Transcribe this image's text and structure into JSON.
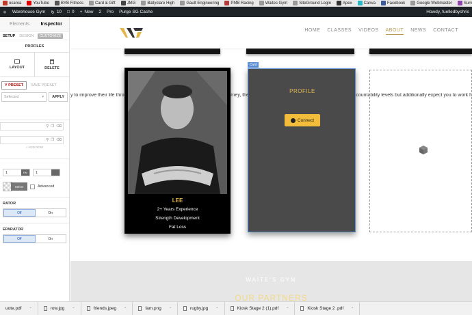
{
  "bookmarks": [
    {
      "label": "ocaroa",
      "color": "#c0392b"
    },
    {
      "label": "YouTube",
      "color": "#e00000"
    },
    {
      "label": "BYB Fitness",
      "color": "#555555"
    },
    {
      "label": "Card & Gift",
      "color": "#999999"
    },
    {
      "label": "JMG",
      "color": "#444444"
    },
    {
      "label": "Ballyclare High",
      "color": "#999999"
    },
    {
      "label": "Gault Engineering",
      "color": "#999999"
    },
    {
      "label": "PMB Racing",
      "color": "#b33a3a"
    },
    {
      "label": "Waites Gym",
      "color": "#999999"
    },
    {
      "label": "SiteGround Login",
      "color": "#999999"
    },
    {
      "label": "Apex",
      "color": "#333333"
    },
    {
      "label": "Canva",
      "color": "#2ab4c4"
    },
    {
      "label": "Facebook",
      "color": "#3b5998"
    },
    {
      "label": "Google Webmaster",
      "color": "#999999"
    },
    {
      "label": "Survey - Gi",
      "color": "#8e44ad"
    }
  ],
  "admin": {
    "site": "Warehouse Gym",
    "updates": "10",
    "comments": "0",
    "new": "New",
    "wpforms": "2",
    "pro": "Pro",
    "purge": "Purge SG Cache",
    "howdy": "Howdy, fuelledbychris"
  },
  "sidebar": {
    "tab_elements": "Elements",
    "tab_inspector": "Inspector",
    "setup": "SETUP",
    "design": "DESIGN",
    "customize": "CUSTOMIZE",
    "profiles": "PROFILES",
    "layout": "LAYOUT",
    "delete": "DELETE",
    "apply_preset": "Y PRESET",
    "save_preset": "SAVE PRESET",
    "selected": "Selected",
    "apply": "APPLY",
    "add_row": "+ ADD ROW",
    "num1": "1",
    "unit1": "EM",
    "num2": "1",
    "select": "Select",
    "advanced": "Advanced",
    "separator1": "RATOR",
    "off": "Off",
    "on": "On",
    "separator2": "EPARATOR"
  },
  "nav": {
    "links": [
      "HOME",
      "CLASSES",
      "VIDEOS",
      "ABOUT",
      "NEWS",
      "CONTACT"
    ],
    "current": "ABOUT"
  },
  "top_cards": [
    "Strength Development",
    "Fat Loss",
    ""
  ],
  "scroll_text": "y to improve their life through fitness is an incredible feeling. Fitness is a journey, there are no fast and easy solutions. I provide high accountability levels but additionally expect you to work hard. I want you",
  "card1": {
    "name": "LEE",
    "lines": [
      "2+ Years Experience",
      "Strength Development",
      "Fat Loss"
    ]
  },
  "card2": {
    "tag": "Card",
    "title": "PROFILE",
    "button": "Connect"
  },
  "footer": {
    "heading": "WAITE'S GYM",
    "sub": "OUR PARTNERS"
  },
  "downloads": [
    "uote.pdf",
    "row.jpg",
    "friends.jpeg",
    "fam.png",
    "rugby.jpg",
    "Kiosk Stage 2 (1).pdf",
    "Kiosk Stage 2 .pdf"
  ]
}
